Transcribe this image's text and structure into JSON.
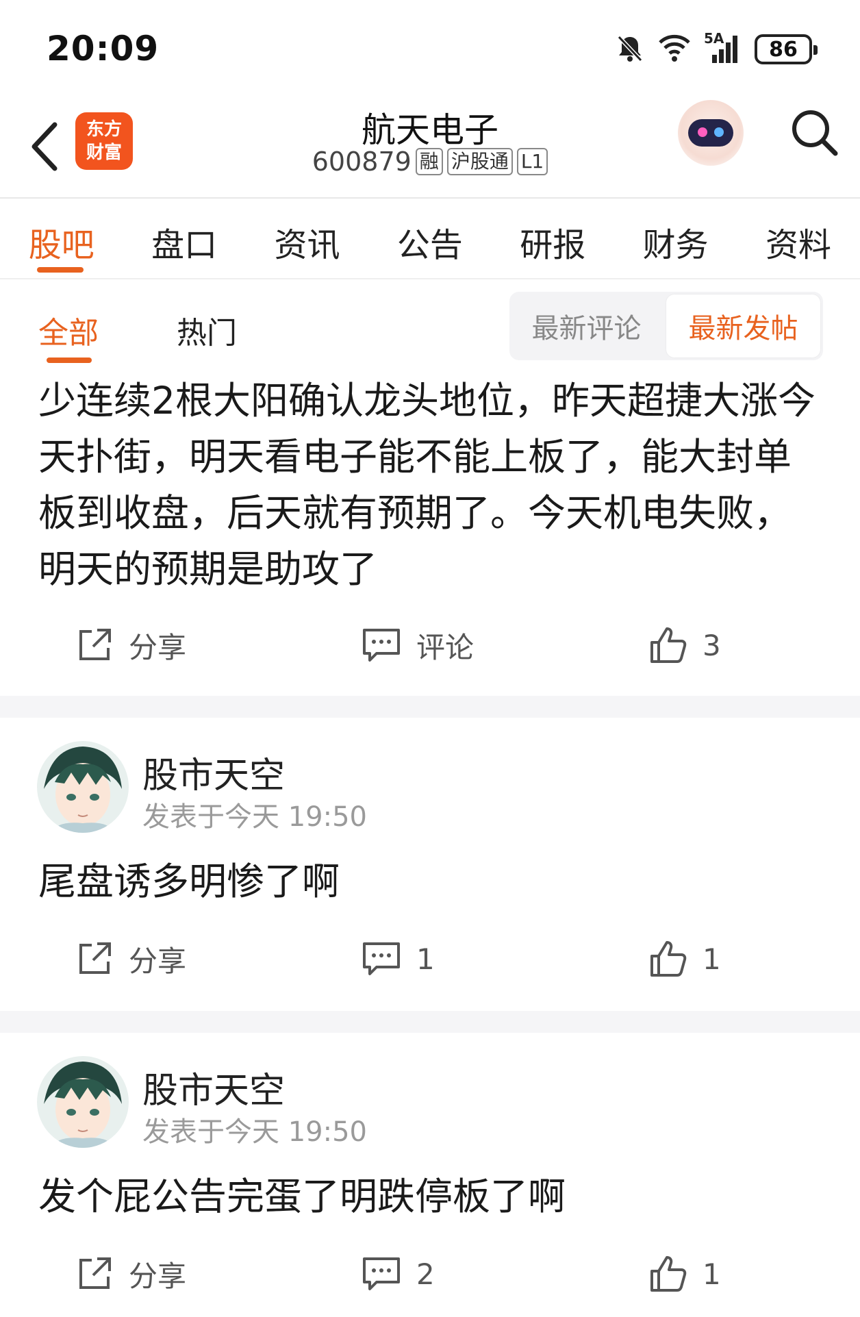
{
  "status_bar": {
    "time": "20:09",
    "network": "5A",
    "battery": "86"
  },
  "header": {
    "brand_logo_line1": "东方",
    "brand_logo_line2": "财富",
    "title": "航天电子",
    "stock_code": "600879",
    "tags": [
      "融",
      "沪股通",
      "L1"
    ]
  },
  "main_tabs": [
    "股吧",
    "盘口",
    "资讯",
    "公告",
    "研报",
    "财务",
    "资料"
  ],
  "sub_tabs": {
    "all": "全部",
    "hot": "热门"
  },
  "sort_options": {
    "latest_comment": "最新评论",
    "latest_post": "最新发帖"
  },
  "posts": [
    {
      "text": "少连续2根大阳确认龙头地位，昨天超捷大涨今天扑街，明天看电子能不能上板了，能大封单板到收盘，后天就有预期了。今天机电失败，明天的预期是助攻了",
      "share": "分享",
      "comment": "评论",
      "likes": "3"
    },
    {
      "author": "股市天空",
      "time": "发表于今天 19:50",
      "text": "尾盘诱多明惨了啊",
      "share": "分享",
      "comment": "1",
      "likes": "1"
    },
    {
      "author": "股市天空",
      "time": "发表于今天 19:50",
      "text": "发个屁公告完蛋了明跌停板了啊",
      "share": "分享",
      "comment": "2",
      "likes": "1"
    }
  ],
  "colors": {
    "accent": "#e8621f",
    "brand": "#f2541e",
    "divider": "#f5f5f7"
  }
}
